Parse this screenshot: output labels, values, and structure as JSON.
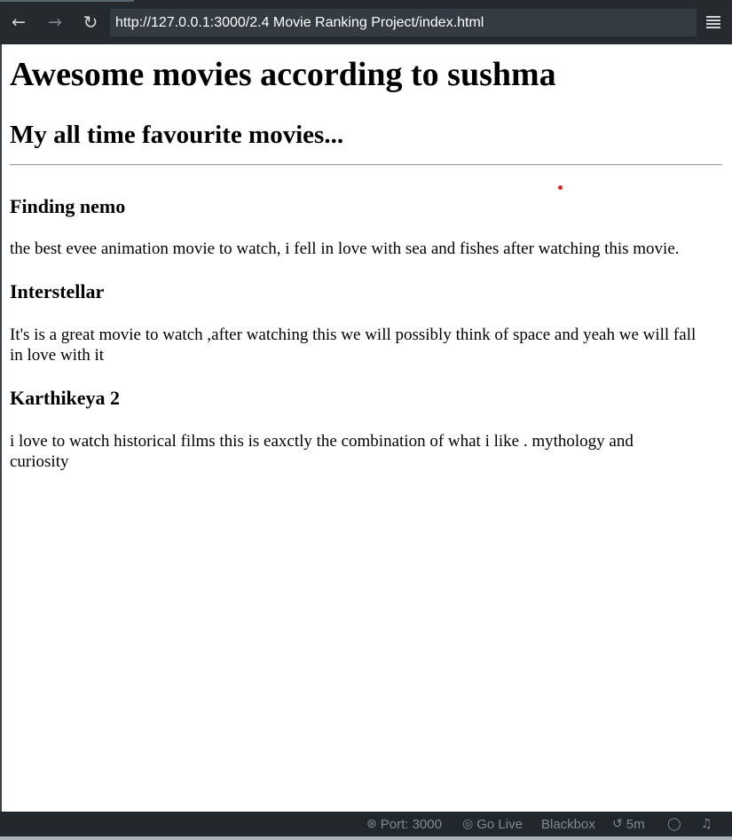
{
  "browser": {
    "back_icon": "arrow-left-icon",
    "forward_icon": "arrow-right-icon",
    "reload_icon": "reload-icon",
    "url": "http://127.0.0.1:3000/2.4 Movie Ranking Project/index.html",
    "menu_icon": "hamburger-menu-icon"
  },
  "page": {
    "title": "Awesome movies according to sushma",
    "subtitle": "My all time favourite movies...",
    "movies": [
      {
        "title": "Finding nemo",
        "description": "the best evee animation movie to watch, i fell in love with sea and fishes after watching this movie."
      },
      {
        "title": "Interstellar",
        "description": "It's is a great movie to watch ,after watching this we will possibly think of space and yeah we will fall in love with it"
      },
      {
        "title": "Karthikeya 2",
        "description": "i love to watch historical films this is eaxctly the combination of what i like . mythology and curiosity"
      }
    ]
  },
  "statusbar": {
    "port": "Port: 3000",
    "go_live": "Go Live",
    "blackbox": "Blackbox",
    "timer": "5m"
  },
  "colors": {
    "toolbar_bg": "#252a2f",
    "url_bar_bg": "#343b42",
    "statusbar_bg": "#22272c",
    "status_text": "#7f8a94",
    "dot": "#e02020"
  }
}
